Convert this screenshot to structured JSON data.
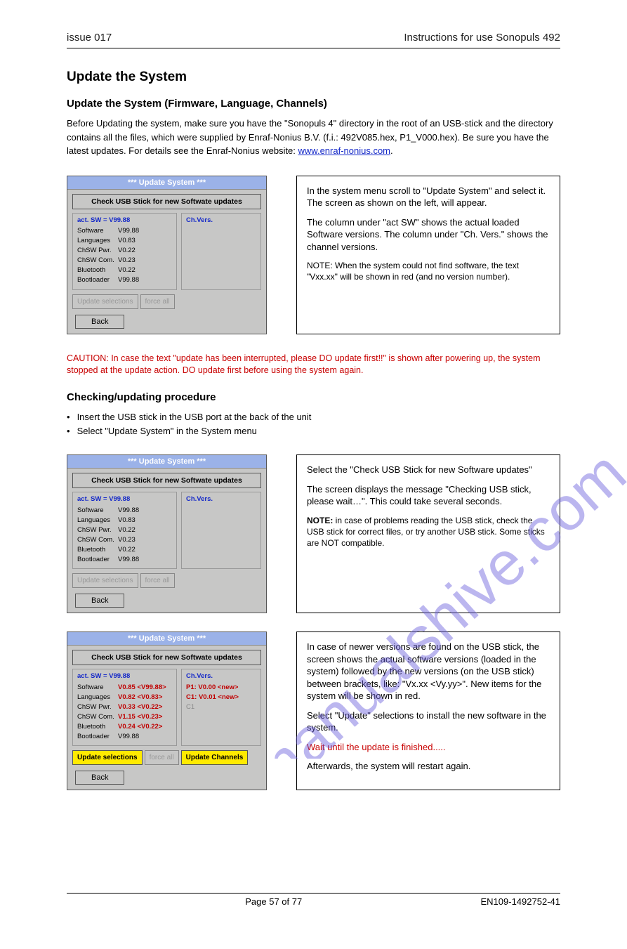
{
  "header": {
    "left": "issue 017",
    "right": "Instructions for use Sonopuls 492"
  },
  "section": {
    "title": "Update the System",
    "sub": "Update the System (Firmware, Language, Channels)",
    "intro1": "Before Updating the system, make sure you have the \"Sonopuls 4\" directory in the root of an USB-stick and the directory contains all the files, which were supplied by Enraf-Nonius B.V. (f.i.: 492V085.hex, P1_V000.hex). Be sure you have the latest updates. For details see the Enraf-Nonius website: ",
    "website": "www.enraf-nonius.com",
    "intro2": "."
  },
  "panel": {
    "title": "***  Update System  ***",
    "check_btn": "Check USB Stick for new Softwate updates",
    "left_header": "act. SW = V99.88",
    "right_header": "Ch.Vers.",
    "rows": [
      {
        "lbl": "Software",
        "val": "V99.88"
      },
      {
        "lbl": "Languages",
        "val": "V0.83"
      },
      {
        "lbl": "ChSW Pwr.",
        "val": "V0.22"
      },
      {
        "lbl": "ChSW Com.",
        "val": "V0.23"
      },
      {
        "lbl": "Bluetooth",
        "val": "V0.22"
      },
      {
        "lbl": "Bootloader",
        "val": "V99.88"
      }
    ],
    "btns": {
      "update_sel": "Update selections",
      "force_all": "force all",
      "update_ch": "Update Channels",
      "back": "Back"
    }
  },
  "panel3": {
    "rows": [
      {
        "lbl": "Software",
        "val": "V0.85 <V99.88>",
        "red": true
      },
      {
        "lbl": "Languages",
        "val": "V0.82 <V0.83>",
        "red": true
      },
      {
        "lbl": "ChSW Pwr.",
        "val": "V0.33 <V0.22>",
        "red": true
      },
      {
        "lbl": "ChSW Com.",
        "val": "V1.15 <V0.23>",
        "red": true
      },
      {
        "lbl": "Bluetooth",
        "val": "V0.24 <V0.22>",
        "red": true
      },
      {
        "lbl": "Bootloader",
        "val": "V99.88",
        "red": false
      }
    ],
    "ch": [
      {
        "txt": "P1: V0.00 <new>",
        "cls": "red"
      },
      {
        "txt": "C1: V0.01 <new>",
        "cls": "red"
      },
      {
        "txt": "C1",
        "cls": "grey"
      }
    ]
  },
  "desc1": {
    "p1": "In the system menu scroll to \"Update System\" and select it. The screen as shown on the left, will appear.",
    "p2": "The column under \"act SW\" shows the actual loaded Software versions. The column under \"Ch. Vers.\" shows the channel versions.",
    "p3": "NOTE: When the system could not find software, the text \"Vxx.xx\" will be shown in red (and no version number)."
  },
  "warn": "CAUTION: In case the text \"update has been interrupted, please DO update first!!\" is shown after powering up, the system stopped at the update action. DO update first before using the system again.",
  "proc_title": "Checking/updating procedure",
  "bullets": [
    "Insert the USB stick in the USB port at the back of the unit",
    "Select \"Update System\" in the System menu"
  ],
  "desc2": {
    "p1": "Select the \"Check USB Stick for new Software updates\"",
    "p2": "The screen displays the message \"Checking USB stick, please wait…\". This could take several seconds.",
    "note_lbl": "NOTE:",
    "note": " in case of problems reading the USB stick, check the USB stick for correct files, or try another USB stick. Some sticks are NOT compatible."
  },
  "desc3": {
    "p1": "In case of newer versions are found on the USB stick, the screen shows the actual software versions (loaded in the system) followed by the new versions (on the USB stick) between brackets, like: \"Vx.xx <Vy.yy>\". New items for the system will be shown in red.",
    "p2": "Select \"Update\" selections to install the new software in the system.",
    "wait": "Wait until the update is finished.....",
    "restart": "Afterwards, the system will restart again."
  },
  "footer": {
    "center": "Page 57 of 77",
    "right": "EN109-1492752-41"
  },
  "watermark": "manualshive.com"
}
